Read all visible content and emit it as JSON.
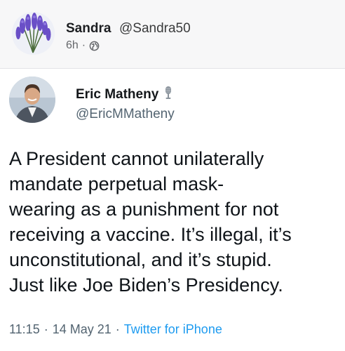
{
  "post": {
    "poster_name": "Sandra",
    "poster_handle": "@Sandra50",
    "time": "6h",
    "separator": "·",
    "audience_icon": "globe-icon"
  },
  "tweet": {
    "author_name": "Eric Matheny",
    "author_handle": "@EricMMatheny",
    "badge_icon": "microphone-icon",
    "text": "A President cannot unilaterally\nmandate perpetual mask-\nwearing as a punishment for not\nreceiving a vaccine. It’s illegal, it’s\nunconstitutional, and it’s stupid.\nJust like Joe Biden’s Presidency.",
    "time": "11:15",
    "date": "14 May 21",
    "source": "Twitter for iPhone",
    "separator": "·"
  },
  "colors": {
    "link_blue": "#1d9bf0",
    "muted_gray": "#536471"
  }
}
